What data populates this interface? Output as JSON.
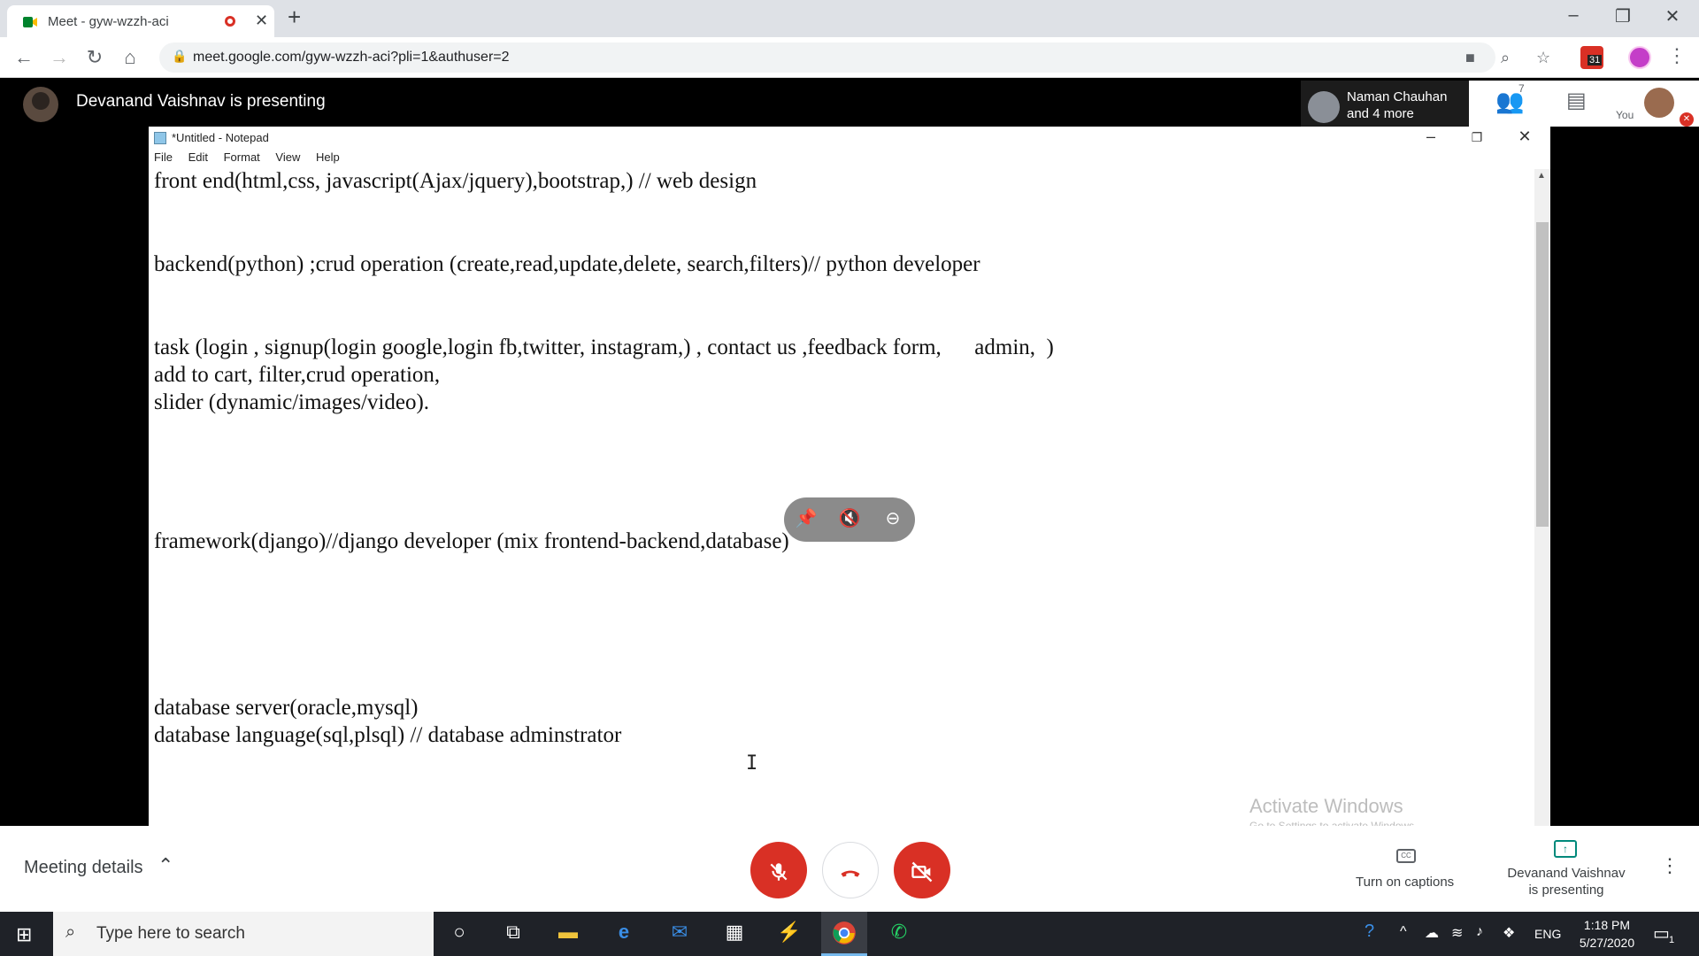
{
  "browser": {
    "tab_title": "Meet - gyw-wzzh-aci",
    "url": "meet.google.com/gyw-wzzh-aci?pli=1&authuser=2",
    "calendar_badge": "31"
  },
  "meet": {
    "presenting_title": "Devanand Vaishnav is presenting",
    "participants_line1": "Naman Chauhan",
    "participants_line2": "and 4 more",
    "people_count": "7",
    "you_label": "You",
    "meeting_details": "Meeting details",
    "captions_label": "Turn on captions",
    "presenting_line1": "Devanand Vaishnav",
    "presenting_line2": "is presenting"
  },
  "notepad": {
    "title": "*Untitled - Notepad",
    "menu": [
      "File",
      "Edit",
      "Format",
      "View",
      "Help"
    ],
    "lines": [
      "front end(html,css, javascript(Ajax/jquery),bootstrap,) // web design",
      "",
      "",
      "backend(python) ;crud operation (create,read,update,delete, search,filters)// python developer",
      "",
      "",
      "task (login , signup(login google,login fb,twitter, instagram,) , contact us ,feedback form,      admin,  )",
      "add to cart, filter,crud operation,",
      "slider (dynamic/images/video).",
      "",
      "",
      "",
      "",
      "framework(django)//django developer (mix frontend-backend,database)",
      "",
      "",
      "",
      "",
      "",
      "database server(oracle,mysql)",
      "database language(sql,plsql) // database adminstrator"
    ],
    "watermark": "Activate Windows",
    "watermark_sub": "Go to Settings to activate Windows."
  },
  "taskbar": {
    "search_placeholder": "Type here to search",
    "language": "ENG",
    "time": "1:18 PM",
    "date": "5/27/2020",
    "notification_count": "1"
  },
  "colors": {
    "meet_red": "#d93025",
    "meet_teal": "#00897b",
    "taskbar_bg": "#1f2228"
  }
}
